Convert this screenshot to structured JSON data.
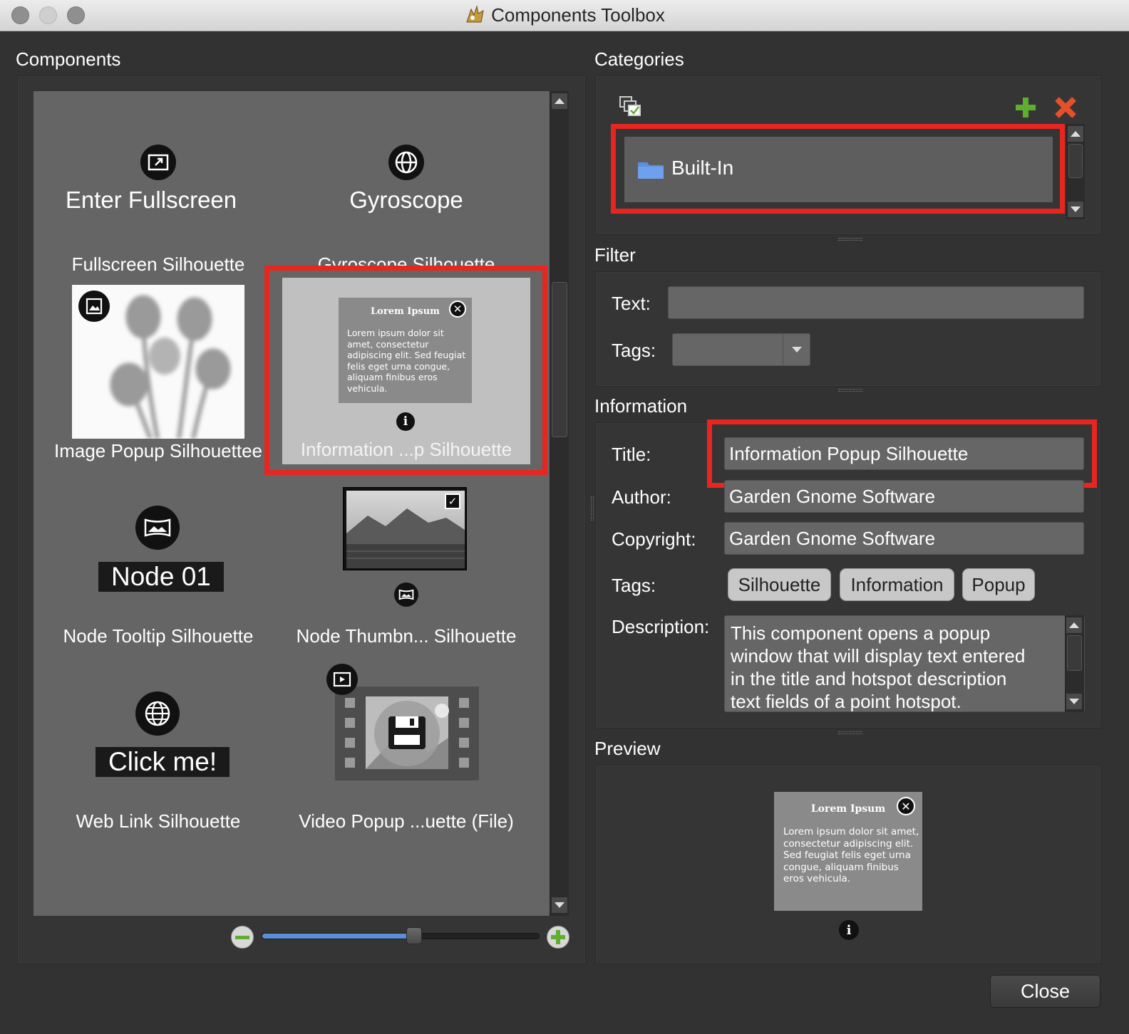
{
  "window": {
    "title": "Components Toolbox"
  },
  "components": {
    "heading": "Components",
    "items": [
      {
        "preview_text": "Enter Fullscreen",
        "label": "Fullscreen Silhouette",
        "icon": "fullscreen-icon"
      },
      {
        "preview_text": "Gyroscope",
        "label": "Gyroscope Silhouette",
        "icon": "gyroscope-icon"
      },
      {
        "label": "Image Popup Silhouettee",
        "icon": "image-icon"
      },
      {
        "label": "Information ...p Silhouette",
        "icon": "info-icon",
        "selected": true
      },
      {
        "preview_text": "Node 01",
        "label": "Node Tooltip Silhouette",
        "icon": "panorama-icon"
      },
      {
        "label": "Node Thumbn... Silhouette",
        "icon": "panorama-icon"
      },
      {
        "preview_text": "Click me!",
        "label": "Web Link Silhouette",
        "icon": "globe-icon"
      },
      {
        "label": "Video Popup ...uette (File)",
        "icon": "video-icon"
      }
    ],
    "zoom_level": 0.55
  },
  "info_preview": {
    "title": "Lorem Ipsum",
    "body": "Lorem ipsum dolor sit amet, consectetur adipiscing elit. Sed feugiat felis eget urna congue, aliquam finibus eros vehicula."
  },
  "categories": {
    "heading": "Categories",
    "items": [
      {
        "label": "Built-In",
        "icon": "folder-icon"
      }
    ]
  },
  "filter": {
    "heading": "Filter",
    "text_label": "Text:",
    "text_value": "",
    "tags_label": "Tags:",
    "tags_value": ""
  },
  "information": {
    "heading": "Information",
    "title_label": "Title:",
    "title_value": "Information Popup Silhouette",
    "author_label": "Author:",
    "author_value": "Garden Gnome Software",
    "copyright_label": "Copyright:",
    "copyright_value": "Garden Gnome Software",
    "tags_label": "Tags:",
    "tags": [
      "Silhouette",
      "Information",
      "Popup"
    ],
    "description_label": "Description:",
    "description_lines": [
      "This component opens a popup",
      "window that will display text entered",
      "in the title and hotspot description",
      "text fields of a point hotspot."
    ]
  },
  "preview": {
    "heading": "Preview"
  },
  "buttons": {
    "close": "Close"
  },
  "colors": {
    "highlight": "#e8261f",
    "add": "#5fae2f",
    "remove": "#e5502a",
    "folder": "#5b8fe0"
  }
}
